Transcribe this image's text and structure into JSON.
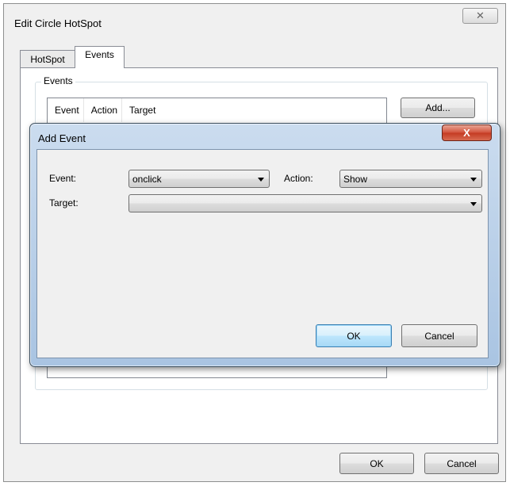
{
  "outer_dialog": {
    "title": "Edit Circle HotSpot",
    "close_glyph": "✕",
    "tabs": [
      {
        "label": "HotSpot",
        "selected": false
      },
      {
        "label": "Events",
        "selected": true
      }
    ],
    "groupbox_label": "Events",
    "list_columns": [
      "Event",
      "Action",
      "Target"
    ],
    "add_button": "Add...",
    "ok_button": "OK",
    "cancel_button": "Cancel"
  },
  "add_event_dialog": {
    "title": "Add Event",
    "close_glyph": "X",
    "event_label": "Event:",
    "event_value": "onclick",
    "action_label": "Action:",
    "action_value": "Show",
    "target_label": "Target:",
    "target_value": "",
    "ok_button": "OK",
    "cancel_button": "Cancel"
  },
  "colors": {
    "modal_frame": "#a9c4e2",
    "close_button_red": "#c43a22",
    "default_button_blue": "#a7d9f5",
    "dialog_background": "#f0f0f0"
  }
}
